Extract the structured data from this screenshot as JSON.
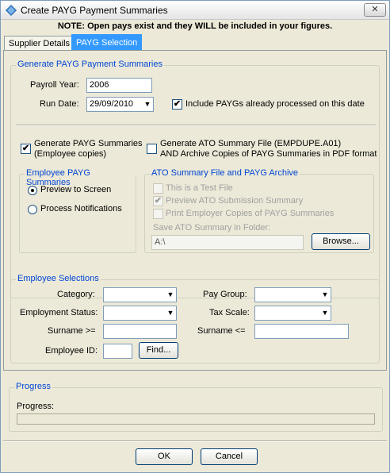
{
  "window": {
    "title": "Create PAYG Payment Summaries",
    "close_glyph": "✕"
  },
  "note": "NOTE:  Open pays exist and they WILL be included in your figures.",
  "tabs": [
    {
      "label": "Supplier Details",
      "active": false
    },
    {
      "label": "PAYG Selection",
      "active": true
    }
  ],
  "generate_group": {
    "legend": "Generate PAYG Payment Summaries",
    "payroll_year_label": "Payroll Year:",
    "payroll_year_value": "2006",
    "run_date_label": "Run Date:",
    "run_date_value": "29/09/2010",
    "include_processed_label": "Include PAYGs already processed on this date",
    "include_processed_checked": true
  },
  "options": {
    "gen_summaries_label_1": "Generate PAYG Summaries",
    "gen_summaries_label_2": "(Employee copies)",
    "gen_summaries_checked": true,
    "gen_ato_label_1": "Generate ATO Summary File (EMPDUPE.A01)",
    "gen_ato_label_2": "AND Archive Copies of PAYG Summaries in PDF format",
    "gen_ato_checked": false
  },
  "employee_group": {
    "legend": "Employee PAYG Summaries",
    "preview_label": "Preview to Screen",
    "preview_selected": true,
    "process_label": "Process Notifications",
    "process_selected": false
  },
  "ato_group": {
    "legend": "ATO Summary File and PAYG Archive",
    "test_file_label": "This is a Test File",
    "test_file_checked": false,
    "preview_ato_label": "Preview ATO Submission Summary",
    "preview_ato_checked": true,
    "print_employer_label": "Print Employer Copies of PAYG Summaries",
    "print_employer_checked": false,
    "save_folder_label": "Save ATO Summary in Folder:",
    "save_folder_value": "A:\\",
    "browse_label": "Browse..."
  },
  "selections": {
    "legend": "Employee Selections",
    "category_label": "Category:",
    "pay_group_label": "Pay Group:",
    "employment_status_label": "Employment Status:",
    "tax_scale_label": "Tax Scale:",
    "surname_from_label": "Surname >=",
    "surname_to_label": "Surname <=",
    "employee_id_label": "Employee ID:",
    "find_label": "Find..."
  },
  "progress": {
    "legend": "Progress",
    "label": "Progress:",
    "value": 0
  },
  "footer": {
    "ok_label": "OK",
    "cancel_label": "Cancel"
  },
  "glyphs": {
    "check": "✔",
    "dropdown": "▼"
  }
}
